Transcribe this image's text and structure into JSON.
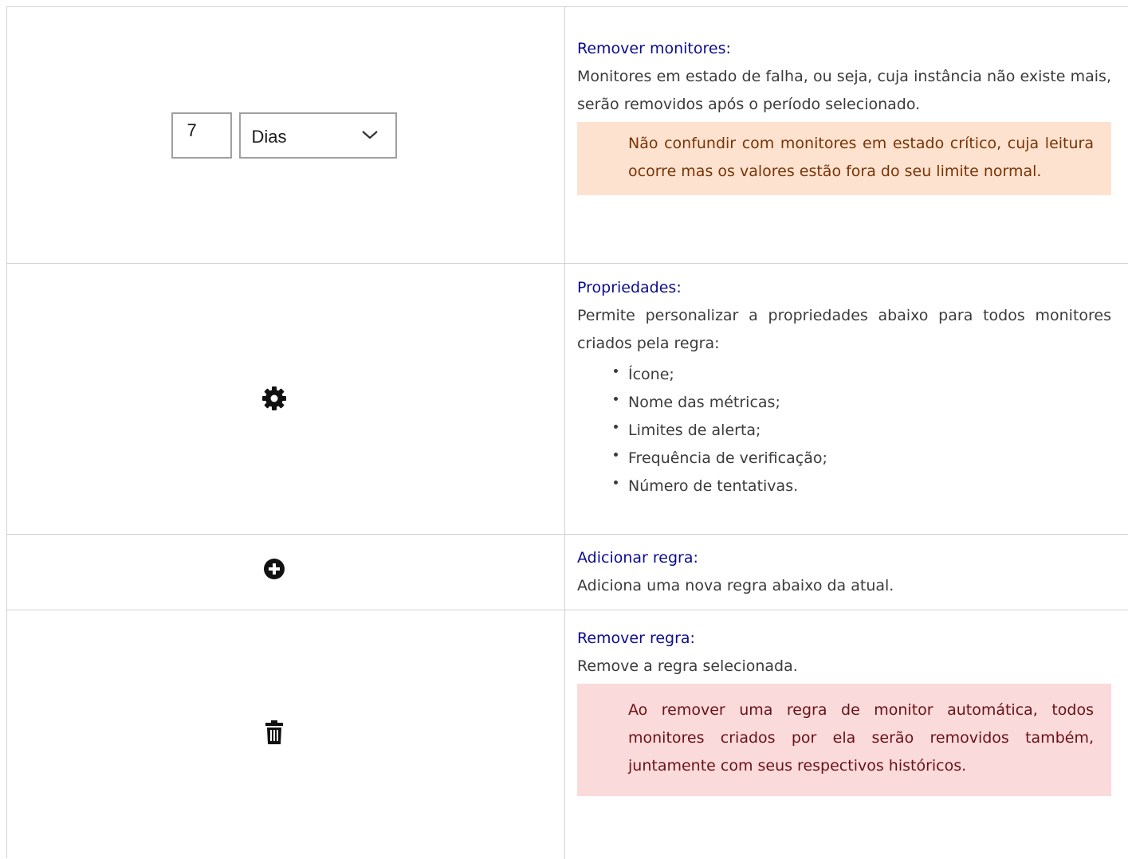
{
  "rows": [
    {
      "control": {
        "number_value": "7",
        "unit_selected": "Dias",
        "icon": "chevron-down-icon"
      },
      "heading": "Remover monitores:",
      "description": "Monitores em estado de falha, ou seja, cuja instância não existe mais, serão removidos após o período selecionado.",
      "note": "Não confundir com monitores em estado crítico, cuja leitura ocorre mas os valores estão fora do seu limite normal."
    },
    {
      "icon": "gear-icon",
      "heading": "Propriedades:",
      "description": "Permite personalizar a propriedades abaixo para todos monitores criados pela regra:",
      "items": [
        "Ícone;",
        "Nome das métricas;",
        "Limites de alerta;",
        "Frequência de verificação;",
        "Número de tentativas."
      ]
    },
    {
      "icon": "plus-circle-icon",
      "heading": "Adicionar regra:",
      "description": "Adiciona uma nova regra abaixo da atual."
    },
    {
      "icon": "trash-icon",
      "heading": "Remover regra:",
      "description": "Remove a regra selecionada.",
      "note": "Ao remover uma regra de monitor automática, todos monitores criados por ela serão removidos também, juntamente com seus respectivos históricos."
    }
  ],
  "colors": {
    "heading": "#0c0c8c",
    "warning_bg": "#fde3cf",
    "warning_text": "#7a3306",
    "danger_bg": "#fadadb",
    "danger_text": "#6a1216",
    "border": "#d2d2d2"
  }
}
